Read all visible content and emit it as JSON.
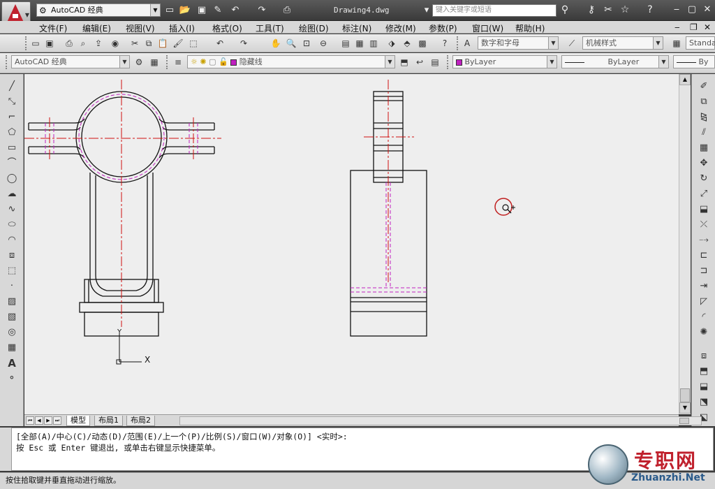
{
  "title_bar": {
    "workspace": "AutoCAD 经典",
    "document_title": "Drawing4.dwg",
    "search_placeholder": "键入关键字或短语"
  },
  "menu": [
    "文件(F)",
    "编辑(E)",
    "视图(V)",
    "插入(I)",
    "格式(O)",
    "工具(T)",
    "绘图(D)",
    "标注(N)",
    "修改(M)",
    "参数(P)",
    "窗口(W)",
    "帮助(H)"
  ],
  "toolbar": {
    "text_style": "数字和字母",
    "dim_style": "机械样式",
    "table_style": "Standa",
    "workspace_combo": "AutoCAD 经典",
    "layer": "隐藏线",
    "color": "ByLayer",
    "linetype": "ByLayer",
    "lineweight": "By"
  },
  "tabs": [
    "模型",
    "布局1",
    "布局2"
  ],
  "command": {
    "line1": "[全部(A)/中心(C)/动态(D)/范围(E)/上一个(P)/比例(S)/窗口(W)/对象(O)] <实时>:",
    "line2": "按 Esc 或 Enter 键退出, 或单击右键显示快捷菜单。"
  },
  "status": "按住拾取键并垂直拖动进行缩放。",
  "ucs": {
    "x_label": "X",
    "y_label": "Y"
  },
  "watermark": {
    "name": "专职网",
    "url": "Zhuanzhi.Net"
  },
  "colors": {
    "layer_color": "#c020c0",
    "center_line": "#d01010",
    "hidden_line": "#c020c0",
    "model_bg": "#eeeeee"
  }
}
